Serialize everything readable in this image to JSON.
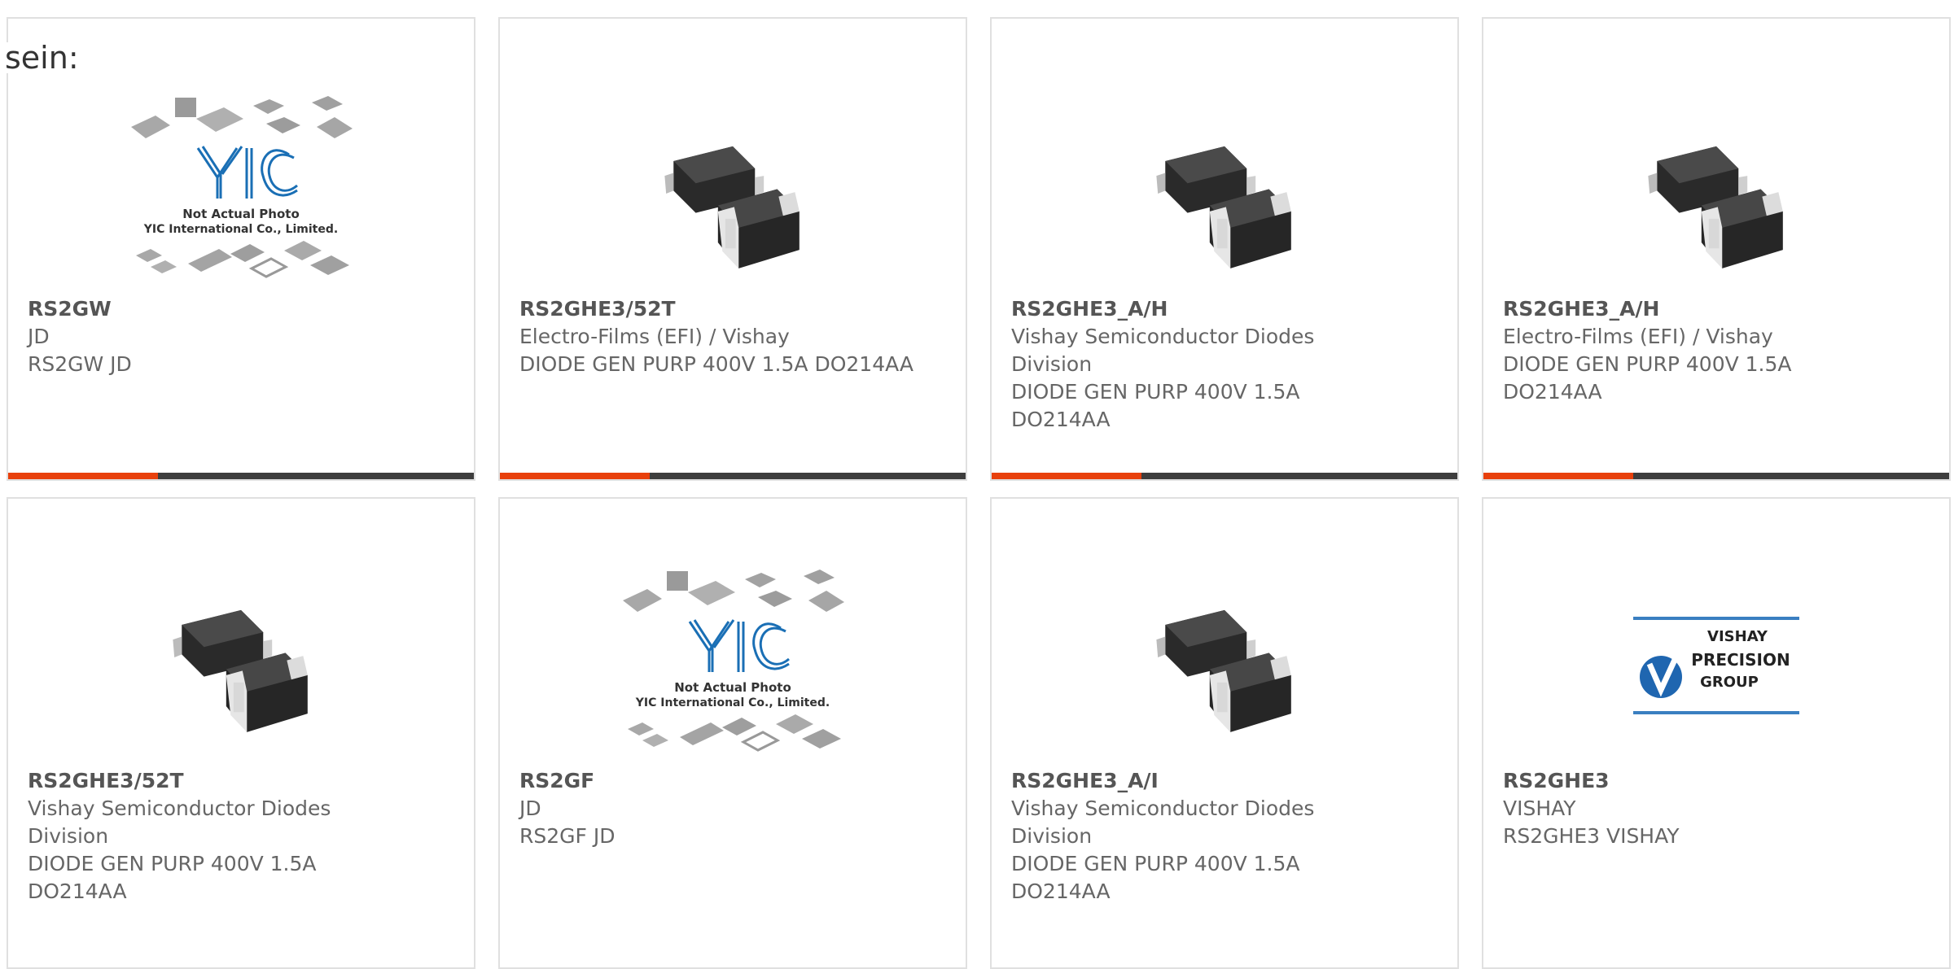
{
  "intro": {
    "text": "sein:"
  },
  "colors": {
    "accent": "#e8400c",
    "bar": "#3d3d3d",
    "text": "#666666",
    "border": "#e0e0e0"
  },
  "yic_placeholder": {
    "line1": "Not Actual Photo",
    "line2": "YIC International Co., Limited."
  },
  "vishay_logo": {
    "line1": "VISHAY",
    "line2": "PRECISION",
    "line3": "GROUP"
  },
  "cards": [
    {
      "part": "RS2GW",
      "maker": "JD",
      "desc": "RS2GW JD",
      "image": "yic-placeholder-image"
    },
    {
      "part": "RS2GHE3/52T",
      "maker": "Electro-Films (EFI) / Vishay",
      "desc": "DIODE GEN PURP 400V 1.5A DO214AA",
      "image": "diode-package-image"
    },
    {
      "part": "RS2GHE3_A/H",
      "maker": "Vishay Semiconductor Diodes Division",
      "desc": "DIODE GEN PURP 400V 1.5A DO214AA",
      "image": "diode-package-image"
    },
    {
      "part": "RS2GHE3_A/H",
      "maker": "Electro-Films (EFI) / Vishay",
      "desc": "DIODE GEN PURP 400V 1.5A DO214AA",
      "image": "diode-package-image"
    },
    {
      "part": "RS2GHE3/52T",
      "maker": "Vishay Semiconductor Diodes Division",
      "desc": "DIODE GEN PURP 400V 1.5A DO214AA",
      "image": "diode-package-image"
    },
    {
      "part": "RS2GF",
      "maker": "JD",
      "desc": "RS2GF JD",
      "image": "yic-placeholder-image"
    },
    {
      "part": "RS2GHE3_A/I",
      "maker": "Vishay Semiconductor Diodes Division",
      "desc": "DIODE GEN PURP 400V 1.5A DO214AA",
      "image": "diode-package-image"
    },
    {
      "part": "RS2GHE3",
      "maker": "VISHAY",
      "desc": "RS2GHE3 VISHAY",
      "image": "vishay-precision-logo"
    }
  ]
}
